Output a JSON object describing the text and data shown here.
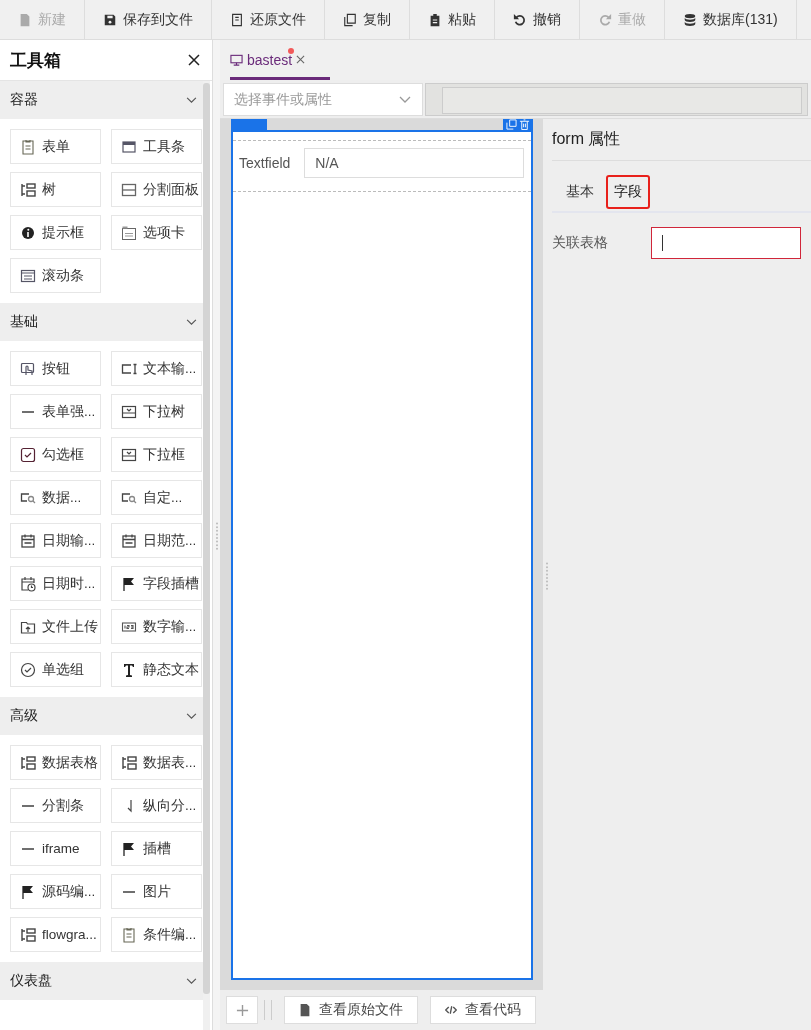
{
  "toolbar": [
    {
      "label": "新建",
      "kind": "new",
      "disabled": true
    },
    {
      "label": "保存到文件",
      "kind": "save",
      "disabled": false
    },
    {
      "label": "还原文件",
      "kind": "restore",
      "disabled": false
    },
    {
      "label": "复制",
      "kind": "copy",
      "disabled": false
    },
    {
      "label": "粘贴",
      "kind": "paste",
      "disabled": false
    },
    {
      "label": "撤销",
      "kind": "undo",
      "disabled": false
    },
    {
      "label": "重做",
      "kind": "redo",
      "disabled": true
    },
    {
      "label": "数据库(131)",
      "kind": "database",
      "disabled": false
    }
  ],
  "toolbox": {
    "title": "工具箱",
    "sections": [
      {
        "title": "容器",
        "items": [
          {
            "label": "表单",
            "kind": "doc"
          },
          {
            "label": "工具条",
            "kind": "toolbar"
          },
          {
            "label": "树",
            "kind": "tree"
          },
          {
            "label": "分割面板",
            "kind": "split"
          },
          {
            "label": "提示框",
            "kind": "info"
          },
          {
            "label": "选项卡",
            "kind": "tab"
          },
          {
            "label": "滚动条",
            "kind": "scroll"
          }
        ]
      },
      {
        "title": "基础",
        "items": [
          {
            "label": "按钮",
            "kind": "hand"
          },
          {
            "label": "文本输...",
            "kind": "textinput"
          },
          {
            "label": "表单强...",
            "kind": "dash"
          },
          {
            "label": "下拉树",
            "kind": "dropdown"
          },
          {
            "label": "勾选框",
            "kind": "checkbox"
          },
          {
            "label": "下拉框",
            "kind": "dropdown"
          },
          {
            "label": "数据...",
            "kind": "search"
          },
          {
            "label": "自定...",
            "kind": "search"
          },
          {
            "label": "日期输...",
            "kind": "calendar"
          },
          {
            "label": "日期范...",
            "kind": "calendar"
          },
          {
            "label": "日期时...",
            "kind": "calclock"
          },
          {
            "label": "字段插槽",
            "kind": "flag"
          },
          {
            "label": "文件上传",
            "kind": "upload"
          },
          {
            "label": "数字输...",
            "kind": "number"
          },
          {
            "label": "单选组",
            "kind": "radio"
          },
          {
            "label": "静态文本",
            "kind": "text"
          }
        ]
      },
      {
        "title": "高级",
        "items": [
          {
            "label": "数据表格",
            "kind": "tree"
          },
          {
            "label": "数据表...",
            "kind": "tree"
          },
          {
            "label": "分割条",
            "kind": "dash"
          },
          {
            "label": "纵向分...",
            "kind": "vline"
          },
          {
            "label": "iframe",
            "kind": "dash"
          },
          {
            "label": "插槽",
            "kind": "flag"
          },
          {
            "label": "源码编...",
            "kind": "flag"
          },
          {
            "label": "图片",
            "kind": "dash"
          },
          {
            "label": "flowgra...",
            "kind": "tree"
          },
          {
            "label": "条件编...",
            "kind": "doc"
          }
        ]
      },
      {
        "title": "仪表盘"
      }
    ]
  },
  "editor_tab": {
    "label": "bastest",
    "modified": true,
    "selected": true
  },
  "event_select": {
    "placeholder": "选择事件或属性"
  },
  "canvas": {
    "form_selected": true,
    "fields": [
      {
        "label": "Textfield",
        "value": "N/A"
      }
    ]
  },
  "bottom_buttons": [
    {
      "label": "查看原始文件",
      "kind": "file"
    },
    {
      "label": "查看代码",
      "kind": "code"
    }
  ],
  "properties": {
    "title": "form 属性",
    "tabs": [
      {
        "label": "基本",
        "selected": false
      },
      {
        "label": "字段",
        "selected": true
      }
    ],
    "fields": [
      {
        "label": "关联表格",
        "invalid": true
      }
    ]
  }
}
